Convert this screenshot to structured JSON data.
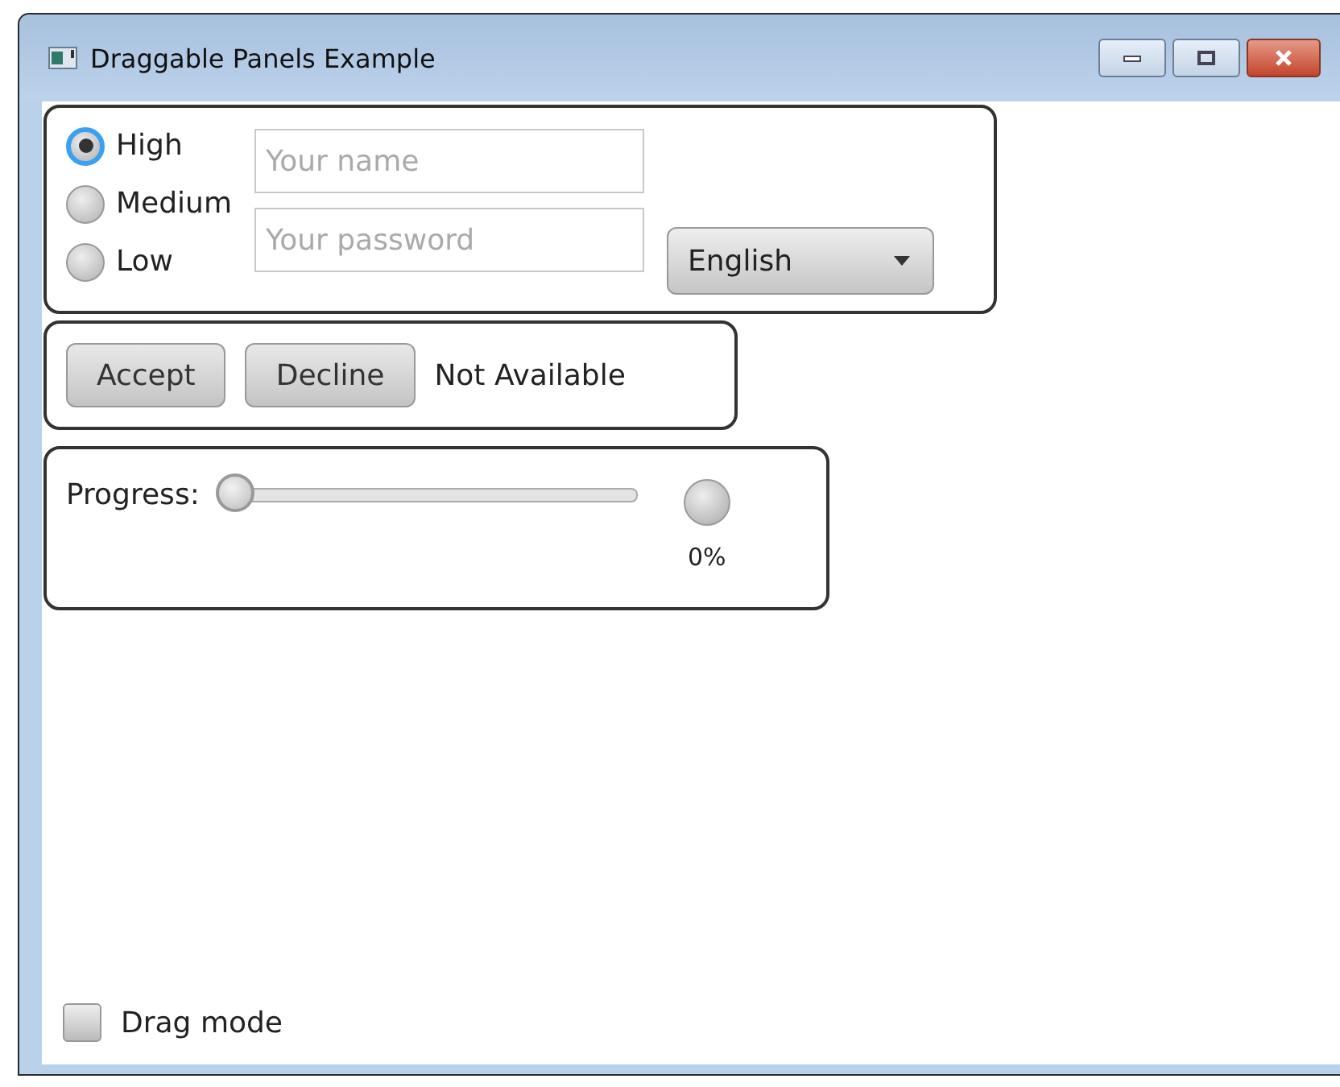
{
  "window": {
    "title": "Draggable Panels Example"
  },
  "radios": [
    {
      "label": "High",
      "selected": true
    },
    {
      "label": "Medium",
      "selected": false
    },
    {
      "label": "Low",
      "selected": false
    }
  ],
  "name_field": {
    "placeholder": "Your name"
  },
  "password_field": {
    "placeholder": "Your password"
  },
  "language": {
    "value": "English"
  },
  "buttons": [
    "Accept",
    "Decline"
  ],
  "status": "Not Available",
  "progress": {
    "label": "Progress:",
    "slider": {
      "level": 0
    },
    "indicator": {
      "reading": "0%"
    }
  },
  "drag_mode": {
    "label": "Drag mode",
    "checked": false
  }
}
